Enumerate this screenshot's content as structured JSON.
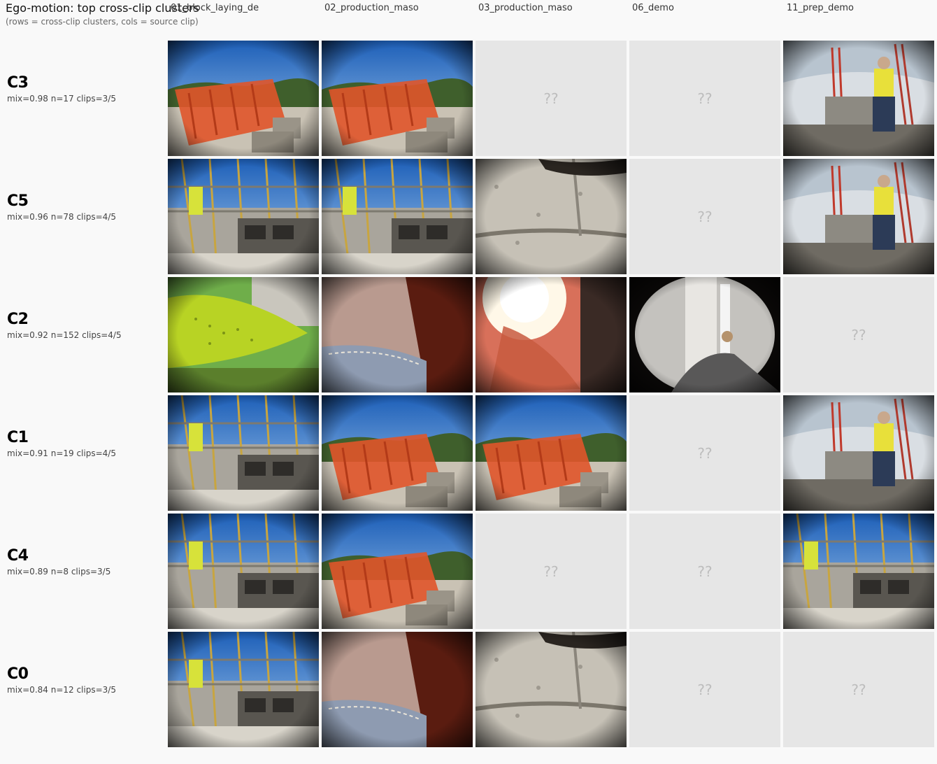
{
  "header": {
    "title": "Ego-motion: top cross-clip clusters",
    "subtitle": "(rows = cross-clip clusters, cols = source clip)"
  },
  "columns": [
    "01_block_laying_de",
    "02_production_maso",
    "03_production_maso",
    "06_demo",
    "11_prep_demo"
  ],
  "missing_marker": "??",
  "rows": [
    {
      "id": "C3",
      "stats": "mix=0.98 n=17 clips=3/5",
      "cells": [
        {
          "present": true,
          "scene": "sky-orange"
        },
        {
          "present": true,
          "scene": "sky-orange"
        },
        {
          "present": false
        },
        {
          "present": false
        },
        {
          "present": true,
          "scene": "crane-wall"
        }
      ]
    },
    {
      "id": "C5",
      "stats": "mix=0.96 n=78 clips=4/5",
      "cells": [
        {
          "present": true,
          "scene": "scaffold"
        },
        {
          "present": true,
          "scene": "scaffold"
        },
        {
          "present": true,
          "scene": "closeup-block"
        },
        {
          "present": false
        },
        {
          "present": true,
          "scene": "crane-wall"
        }
      ]
    },
    {
      "id": "C2",
      "stats": "mix=0.92 n=152 clips=4/5",
      "cells": [
        {
          "present": true,
          "scene": "green-vest"
        },
        {
          "present": true,
          "scene": "skin-closeup"
        },
        {
          "present": true,
          "scene": "glare-red"
        },
        {
          "present": true,
          "scene": "dark-indoor"
        },
        {
          "present": false
        }
      ]
    },
    {
      "id": "C1",
      "stats": "mix=0.91 n=19 clips=4/5",
      "cells": [
        {
          "present": true,
          "scene": "scaffold"
        },
        {
          "present": true,
          "scene": "sky-orange"
        },
        {
          "present": true,
          "scene": "sky-orange"
        },
        {
          "present": false
        },
        {
          "present": true,
          "scene": "crane-wall"
        }
      ]
    },
    {
      "id": "C4",
      "stats": "mix=0.89 n=8 clips=3/5",
      "cells": [
        {
          "present": true,
          "scene": "scaffold"
        },
        {
          "present": true,
          "scene": "sky-orange"
        },
        {
          "present": false
        },
        {
          "present": false
        },
        {
          "present": true,
          "scene": "scaffold"
        }
      ]
    },
    {
      "id": "C0",
      "stats": "mix=0.84 n=12 clips=3/5",
      "cells": [
        {
          "present": true,
          "scene": "scaffold"
        },
        {
          "present": true,
          "scene": "skin-closeup"
        },
        {
          "present": true,
          "scene": "closeup-block"
        },
        {
          "present": false
        },
        {
          "present": false
        }
      ]
    }
  ]
}
